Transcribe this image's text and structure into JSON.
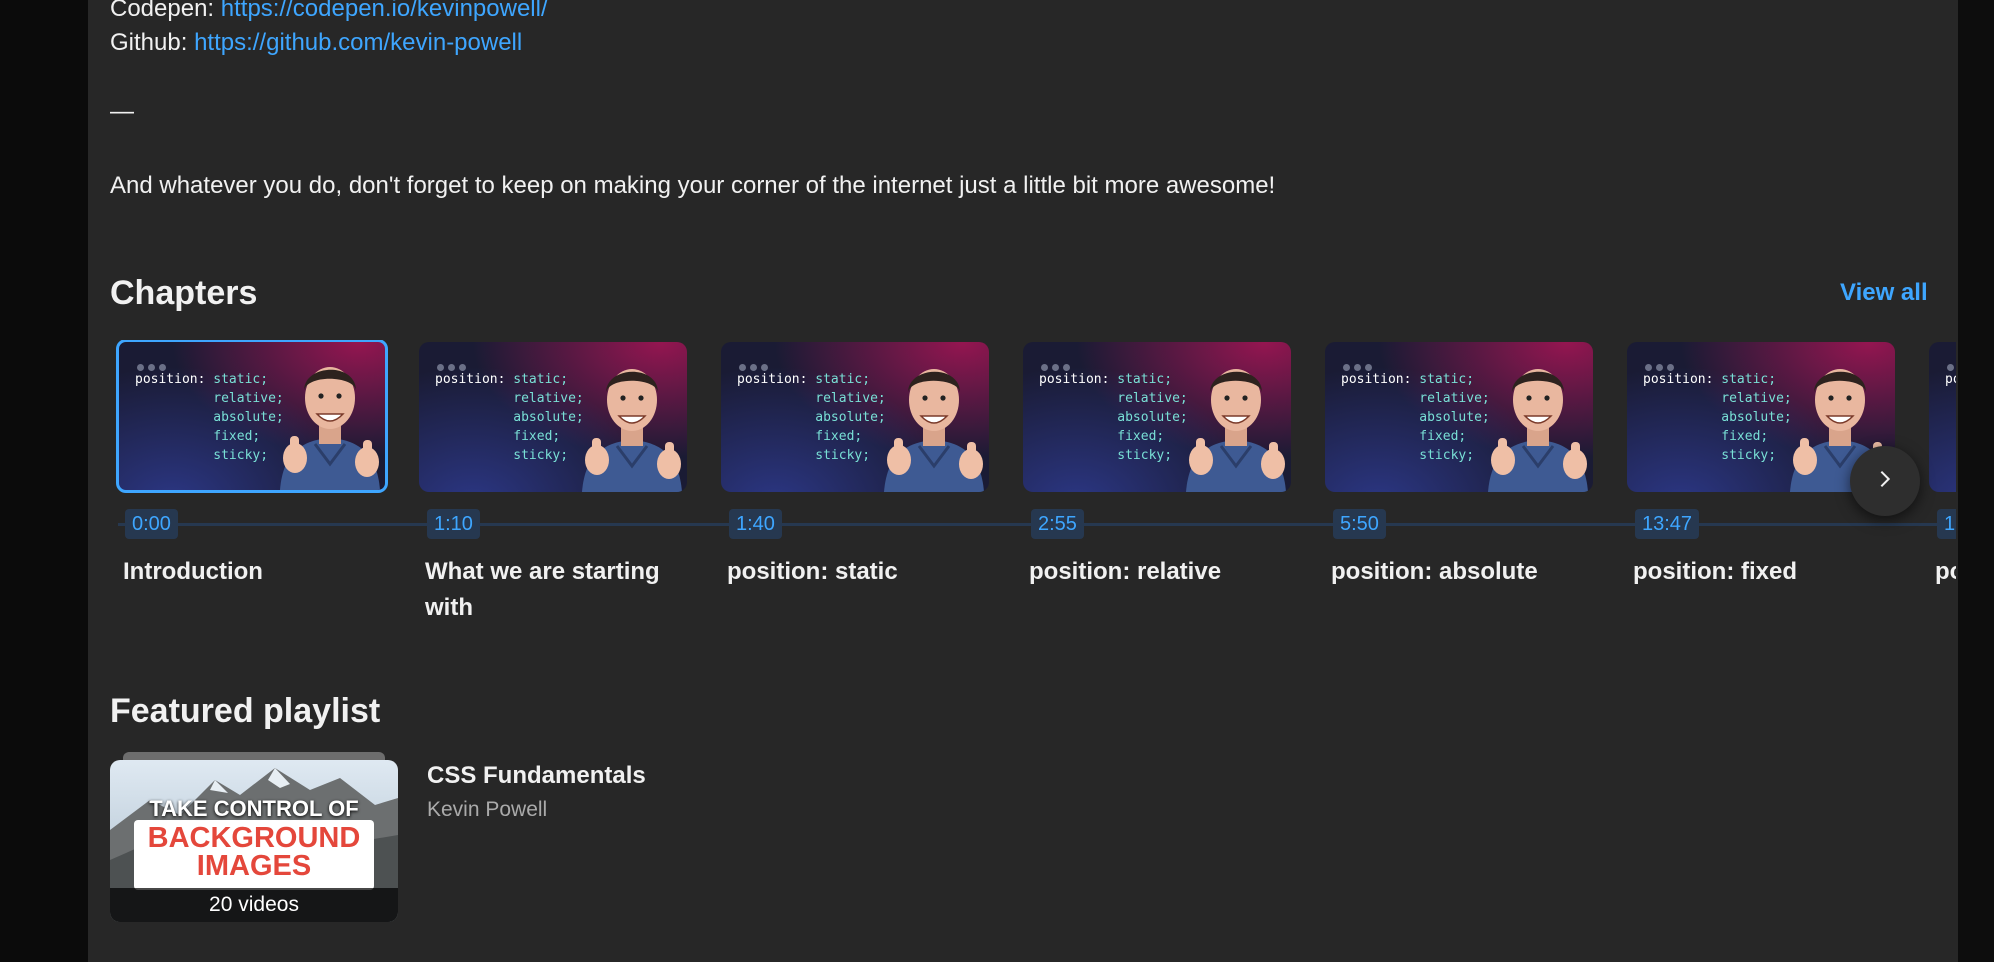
{
  "description": {
    "codepen_label": "Codepen:",
    "codepen_url": "https://codepen.io/kevinpowell/",
    "github_label": "Github:",
    "github_url": "https://github.com/kevin-powell",
    "separator": "—",
    "closing": "And whatever you do, don't forget to keep on making your corner of the internet just a little bit more awesome!"
  },
  "chapters": {
    "heading": "Chapters",
    "view_all": "View all",
    "thumb_code": {
      "keyword": "position:",
      "values": [
        "static;",
        "relative;",
        "absolute;",
        "fixed;",
        "sticky;"
      ]
    },
    "items": [
      {
        "time": "0:00",
        "title": "Introduction",
        "active": true
      },
      {
        "time": "1:10",
        "title": "What we are starting with",
        "active": false
      },
      {
        "time": "1:40",
        "title": "position: static",
        "active": false
      },
      {
        "time": "2:55",
        "title": "position: relative",
        "active": false
      },
      {
        "time": "5:50",
        "title": "position: absolute",
        "active": false
      },
      {
        "time": "13:47",
        "title": "position: fixed",
        "active": false
      },
      {
        "time": "1",
        "title": "po",
        "active": false
      }
    ],
    "next_icon": "chevron-right-icon"
  },
  "featured_playlist": {
    "heading": "Featured playlist",
    "title": "CSS Fundamentals",
    "channel": "Kevin Powell",
    "video_count": "20 videos",
    "thumb_text_1": "TAKE CONTROL OF",
    "thumb_text_2": "BACKGROUND IMAGES"
  },
  "colors": {
    "accent": "#3ea6ff",
    "panel_bg": "#272727",
    "page_bg": "#0f0f0f",
    "timestamp_bg": "#263850"
  }
}
